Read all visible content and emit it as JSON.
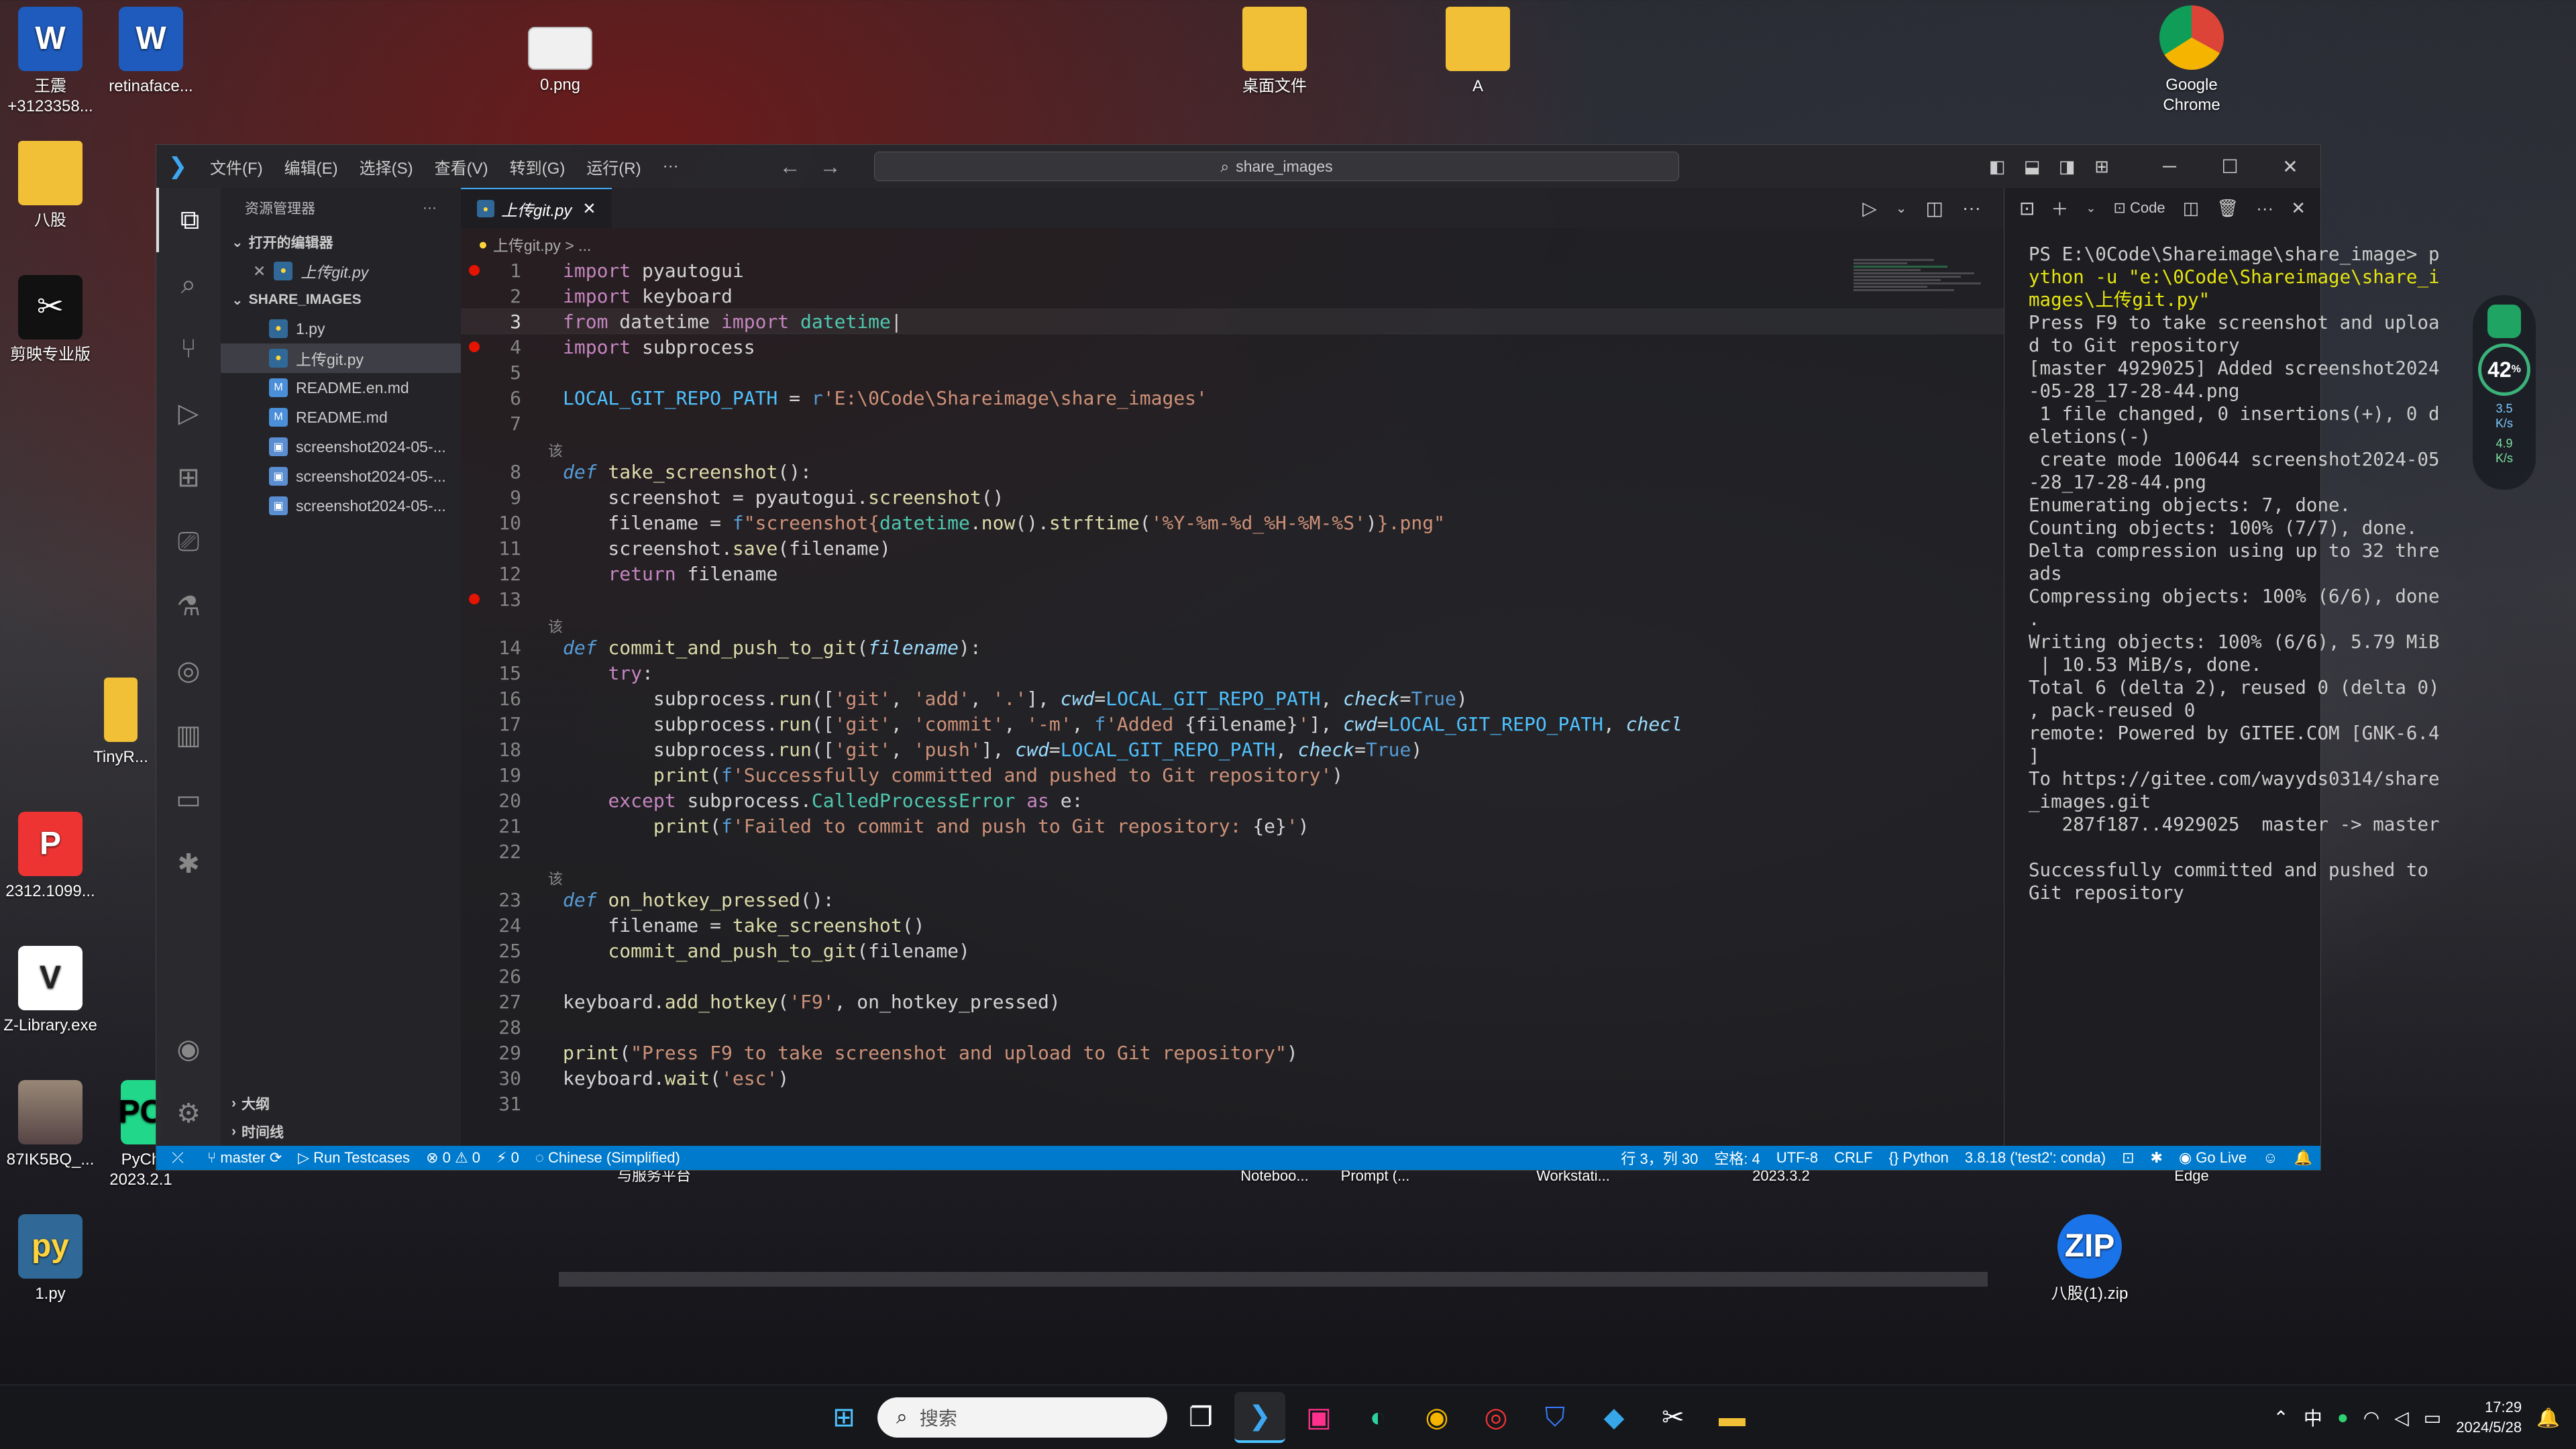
{
  "desktop": {
    "icons": [
      {
        "label": "王震\n+3123358...",
        "glyph": "W"
      },
      {
        "label": "retinaface...",
        "glyph": "W"
      },
      {
        "label": "0.png",
        "glyph": ""
      },
      {
        "label": "桌面文件",
        "glyph": ""
      },
      {
        "label": "A",
        "glyph": ""
      },
      {
        "label": "Google\nChrome",
        "glyph": ""
      },
      {
        "label": "八股",
        "glyph": ""
      },
      {
        "label": "剪映专业版",
        "glyph": "✂"
      },
      {
        "label": "TinyR...",
        "glyph": ""
      },
      {
        "label": "2312.1099...",
        "glyph": "P"
      },
      {
        "label": "Z-Library.exe",
        "glyph": "V"
      },
      {
        "label": "87IK5BQ_...",
        "glyph": ""
      },
      {
        "label": "PyCh\n2023.2.1",
        "glyph": "PC"
      },
      {
        "label": "1.py",
        "glyph": "py"
      },
      {
        "label": "八股(1).zip",
        "glyph": "ZIP"
      }
    ],
    "partial_labels": [
      "与服务平台",
      "Noteboo...",
      "Prompt (...",
      "Workstati...",
      "2023.3.2",
      "Edge"
    ]
  },
  "window": {
    "menu": [
      "文件(F)",
      "编辑(E)",
      "选择(S)",
      "查看(V)",
      "转到(G)",
      "运行(R)",
      "···"
    ],
    "search": "share_images"
  },
  "sidebar": {
    "title": "资源管理器",
    "open_editors_label": "打开的编辑器",
    "open_editors": [
      {
        "name": "上传git.py"
      }
    ],
    "project_label": "SHARE_IMAGES",
    "files": [
      {
        "name": "1.py",
        "type": "py"
      },
      {
        "name": "上传git.py",
        "type": "py"
      },
      {
        "name": "README.en.md",
        "type": "md"
      },
      {
        "name": "README.md",
        "type": "md"
      },
      {
        "name": "screenshot2024-05-...",
        "type": "img"
      },
      {
        "name": "screenshot2024-05-...",
        "type": "img"
      },
      {
        "name": "screenshot2024-05-...",
        "type": "img"
      }
    ],
    "outline_label": "大纲",
    "timeline_label": "时间线"
  },
  "editor": {
    "tab_label": "上传git.py",
    "breadcrumb": "上传git.py > ...",
    "code_lens": "该"
  },
  "terminal": {
    "code_label": "Code",
    "lines": [
      "PS E:\\0Code\\Shareimage\\share_image> p",
      "ython -u \"e:\\0Code\\Shareimage\\share_i",
      "mages\\上传git.py\"",
      "Press F9 to take screenshot and uploa",
      "d to Git repository",
      "[master 4929025] Added screenshot2024",
      "-05-28_17-28-44.png",
      " 1 file changed, 0 insertions(+), 0 d",
      "eletions(-)",
      " create mode 100644 screenshot2024-05",
      "-28_17-28-44.png",
      "Enumerating objects: 7, done.",
      "Counting objects: 100% (7/7), done.",
      "Delta compression using up to 32 thre",
      "ads",
      "Compressing objects: 100% (6/6), done",
      ".",
      "Writing objects: 100% (6/6), 5.79 MiB",
      " | 10.53 MiB/s, done.",
      "Total 6 (delta 2), reused 0 (delta 0)",
      ", pack-reused 0",
      "remote: Powered by GITEE.COM [GNK-6.4",
      "]",
      "To https://gitee.com/wayyds0314/share",
      "_images.git",
      "   287f187..4929025  master -> master",
      "",
      "Successfully committed and pushed to",
      "Git repository"
    ]
  },
  "statusbar": {
    "branch": "master",
    "run_testcases": "Run Testcases",
    "problems": "⊗ 0 ⚠ 0",
    "ports": "⚡ 0",
    "language_pack": "Chinese (Simplified)",
    "cursor": "行 3，列 30",
    "spaces": "空格: 4",
    "encoding": "UTF-8",
    "eol": "CRLF",
    "language": "Python",
    "interpreter": "3.8.18 ('test2': conda)",
    "golive": "Go Live"
  },
  "netwidget": {
    "value": "42",
    "unit": "%",
    "up": "3.5\nK/s",
    "down": "4.9\nK/s"
  },
  "taskbar": {
    "search_placeholder": "搜索",
    "ime": "中",
    "time": "17:29",
    "date": "2024/5/28"
  }
}
